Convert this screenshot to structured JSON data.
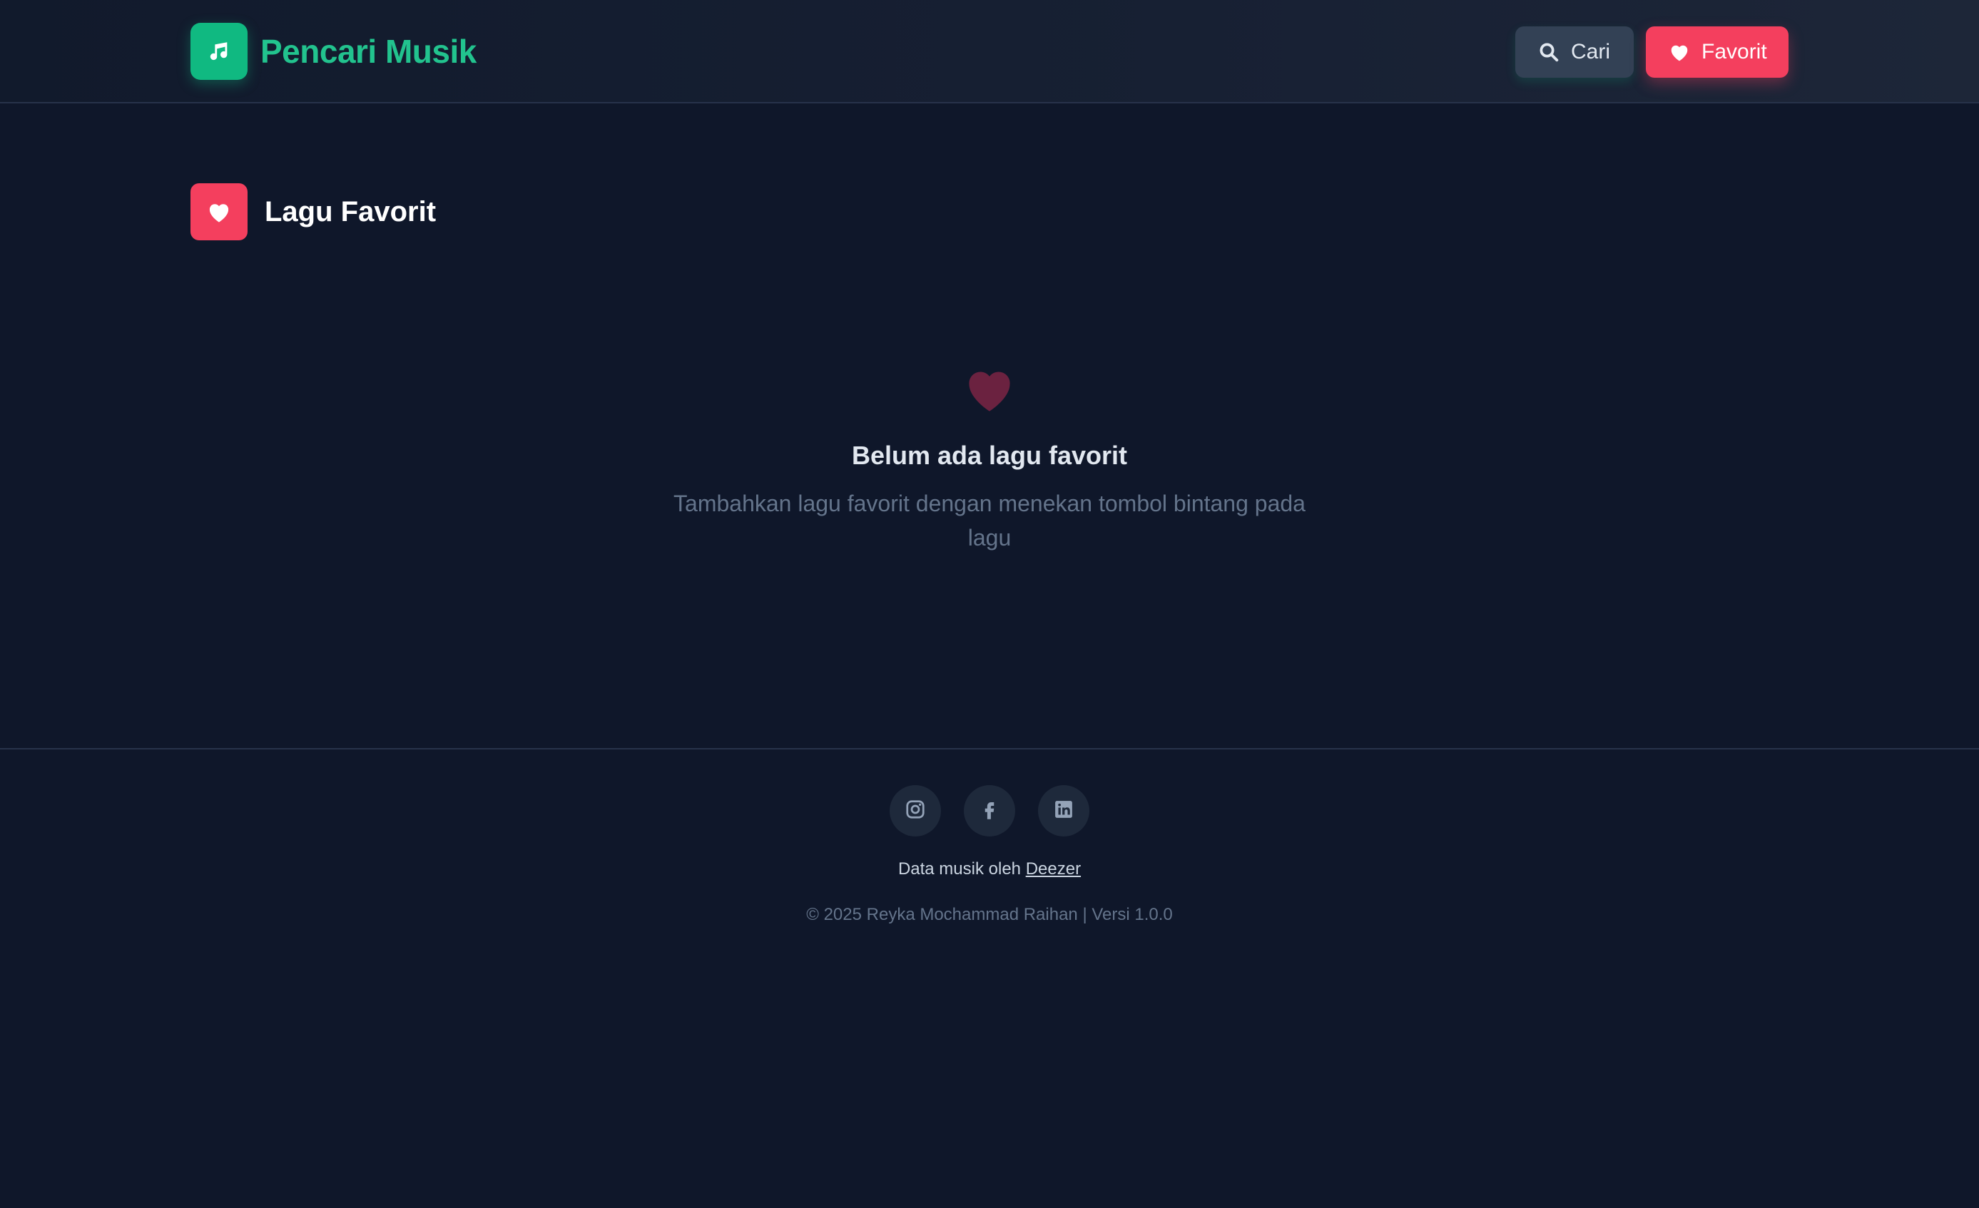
{
  "app": {
    "title": "Pencari Musik",
    "brand_icon": "music-note-icon",
    "accent_color": "#10b981"
  },
  "nav": {
    "search_label": "Cari",
    "search_icon": "search-icon",
    "favorite_label": "Favorit",
    "favorite_icon": "heart-icon",
    "favorite_color": "#f43f5e"
  },
  "page": {
    "title": "Lagu Favorit",
    "title_icon": "heart-icon"
  },
  "empty_state": {
    "icon": "heart-icon",
    "title": "Belum ada lagu favorit",
    "description": "Tambahkan lagu favorit dengan menekan tombol bintang pada lagu"
  },
  "footer": {
    "social": [
      {
        "name": "instagram",
        "icon": "instagram-icon"
      },
      {
        "name": "facebook",
        "icon": "facebook-icon"
      },
      {
        "name": "linkedin",
        "icon": "linkedin-icon"
      }
    ],
    "credit_prefix": "Data musik oleh",
    "credit_link": "Deezer",
    "copyright": "© 2025 Reyka Mochammad Raihan | Versi 1.0.0"
  }
}
